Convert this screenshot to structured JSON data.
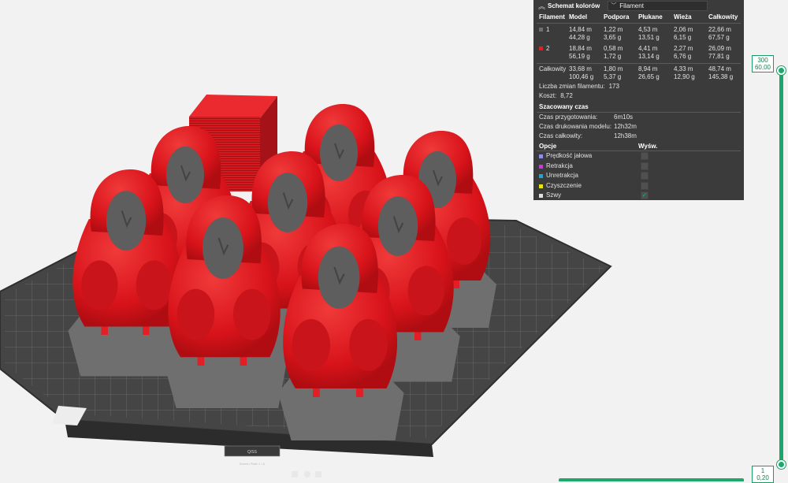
{
  "panel": {
    "title": "Schemat kolorów",
    "color_scheme_value": "Filament",
    "headers": [
      "Filament",
      "Model",
      "Podpora",
      "Płukane",
      "Wieża",
      "Całkowity"
    ],
    "filaments": [
      {
        "id": "1",
        "color": "#707070",
        "model": [
          "14,84 m",
          "44,28 g"
        ],
        "support": [
          "1,22 m",
          "3,65 g"
        ],
        "flushed": [
          "4,53 m",
          "13,51 g"
        ],
        "tower": [
          "2,06 m",
          "6,15 g"
        ],
        "total": [
          "22,66 m",
          "67,57 g"
        ]
      },
      {
        "id": "2",
        "color": "#e31e24",
        "model": [
          "18,84 m",
          "56,19 g"
        ],
        "support": [
          "0,58 m",
          "1,72 g"
        ],
        "flushed": [
          "4,41 m",
          "13,14 g"
        ],
        "tower": [
          "2,27 m",
          "6,76 g"
        ],
        "total": [
          "26,09 m",
          "77,81 g"
        ]
      }
    ],
    "total_row": {
      "label": "Całkowity",
      "model": [
        "33,68 m",
        "100,46 g"
      ],
      "support": [
        "1,80 m",
        "5,37 g"
      ],
      "flushed": [
        "8,94 m",
        "26,65 g"
      ],
      "tower": [
        "4,33 m",
        "12,90 g"
      ],
      "total": [
        "48,74 m",
        "145,38 g"
      ]
    },
    "filament_changes_label": "Liczba zmian filamentu:",
    "filament_changes_value": "173",
    "cost_label": "Koszt:",
    "cost_value": "8,72",
    "estimated_time_title": "Szacowany czas",
    "prep_time_label": "Czas przygotowania:",
    "prep_time_value": "6m10s",
    "model_time_label": "Czas drukowania modelu:",
    "model_time_value": "12h32m",
    "total_time_label": "Czas całkowity:",
    "total_time_value": "12h38m",
    "options_title": "Opcje",
    "display_title": "Wyśw.",
    "options": [
      {
        "label": "Prędkość jałowa",
        "color": "#8f8fe8",
        "checked": false
      },
      {
        "label": "Retrakcja",
        "color": "#c93bd6",
        "checked": false
      },
      {
        "label": "Unretrakcja",
        "color": "#29a3c7",
        "checked": false
      },
      {
        "label": "Czyszczenie",
        "color": "#e6e617",
        "checked": false
      },
      {
        "label": "Szwy",
        "color": "#e0e0e0",
        "checked": true
      }
    ]
  },
  "slider": {
    "top_layer": "300",
    "top_height": "60,00",
    "bottom_layer": "1",
    "bottom_height": "0,20"
  },
  "plate": {
    "bottom_labels": [
      "Q/SS",
      "Bambu Plate 1 / A"
    ]
  },
  "colors": {
    "accent": "#1fa86b",
    "model_red": "#e31e24",
    "model_gray": "#6f6f6f",
    "plate": "#4a4a4a"
  }
}
